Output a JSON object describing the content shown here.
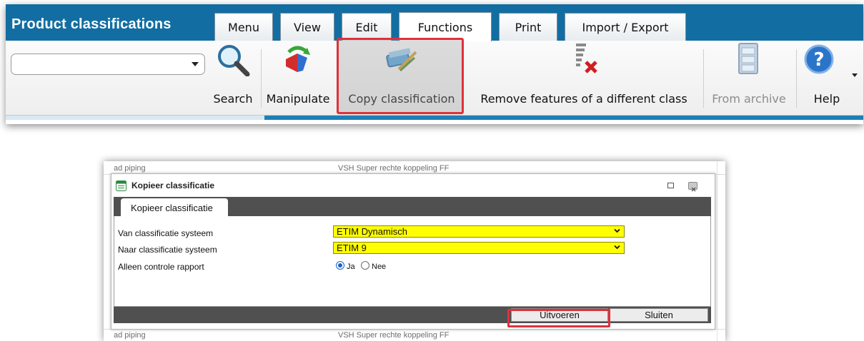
{
  "ribbon": {
    "app_title": "Product classifications",
    "tabs": [
      {
        "label": "Menu"
      },
      {
        "label": "View"
      },
      {
        "label": "Edit"
      },
      {
        "label": "Functions"
      },
      {
        "label": "Print"
      },
      {
        "label": "Import / Export"
      }
    ],
    "active_tab": "Functions",
    "search_combo_value": "",
    "buttons": {
      "search": "Search",
      "manipulate": "Manipulate",
      "copy_classification": "Copy classification",
      "remove_features": "Remove features of a different class",
      "from_archive": "From archive",
      "help": "Help"
    },
    "colors": {
      "header": "#126ea2",
      "highlight": "#e0303a"
    }
  },
  "background_list": {
    "row_top_left": "ad piping",
    "row_top_mid": "VSH Super rechte koppeling FF",
    "row_bottom_left": "ad piping",
    "row_bottom_mid": "VSH Super rechte koppeling FF"
  },
  "dialog": {
    "title": "Kopieer classificatie",
    "tab_label": "Kopieer classificatie",
    "fields": {
      "from_label": "Van classificatie systeem",
      "from_value": "ETIM Dynamisch",
      "to_label": "Naar classificatie systeem",
      "to_value": "ETIM 9",
      "report_label": "Alleen controle rapport",
      "radio_yes": "Ja",
      "radio_no": "Nee",
      "radio_selected": "Ja"
    },
    "buttons": {
      "execute": "Uitvoeren",
      "close": "Sluiten"
    },
    "colors": {
      "select_bg": "#ffff00",
      "bar": "#505050"
    }
  }
}
